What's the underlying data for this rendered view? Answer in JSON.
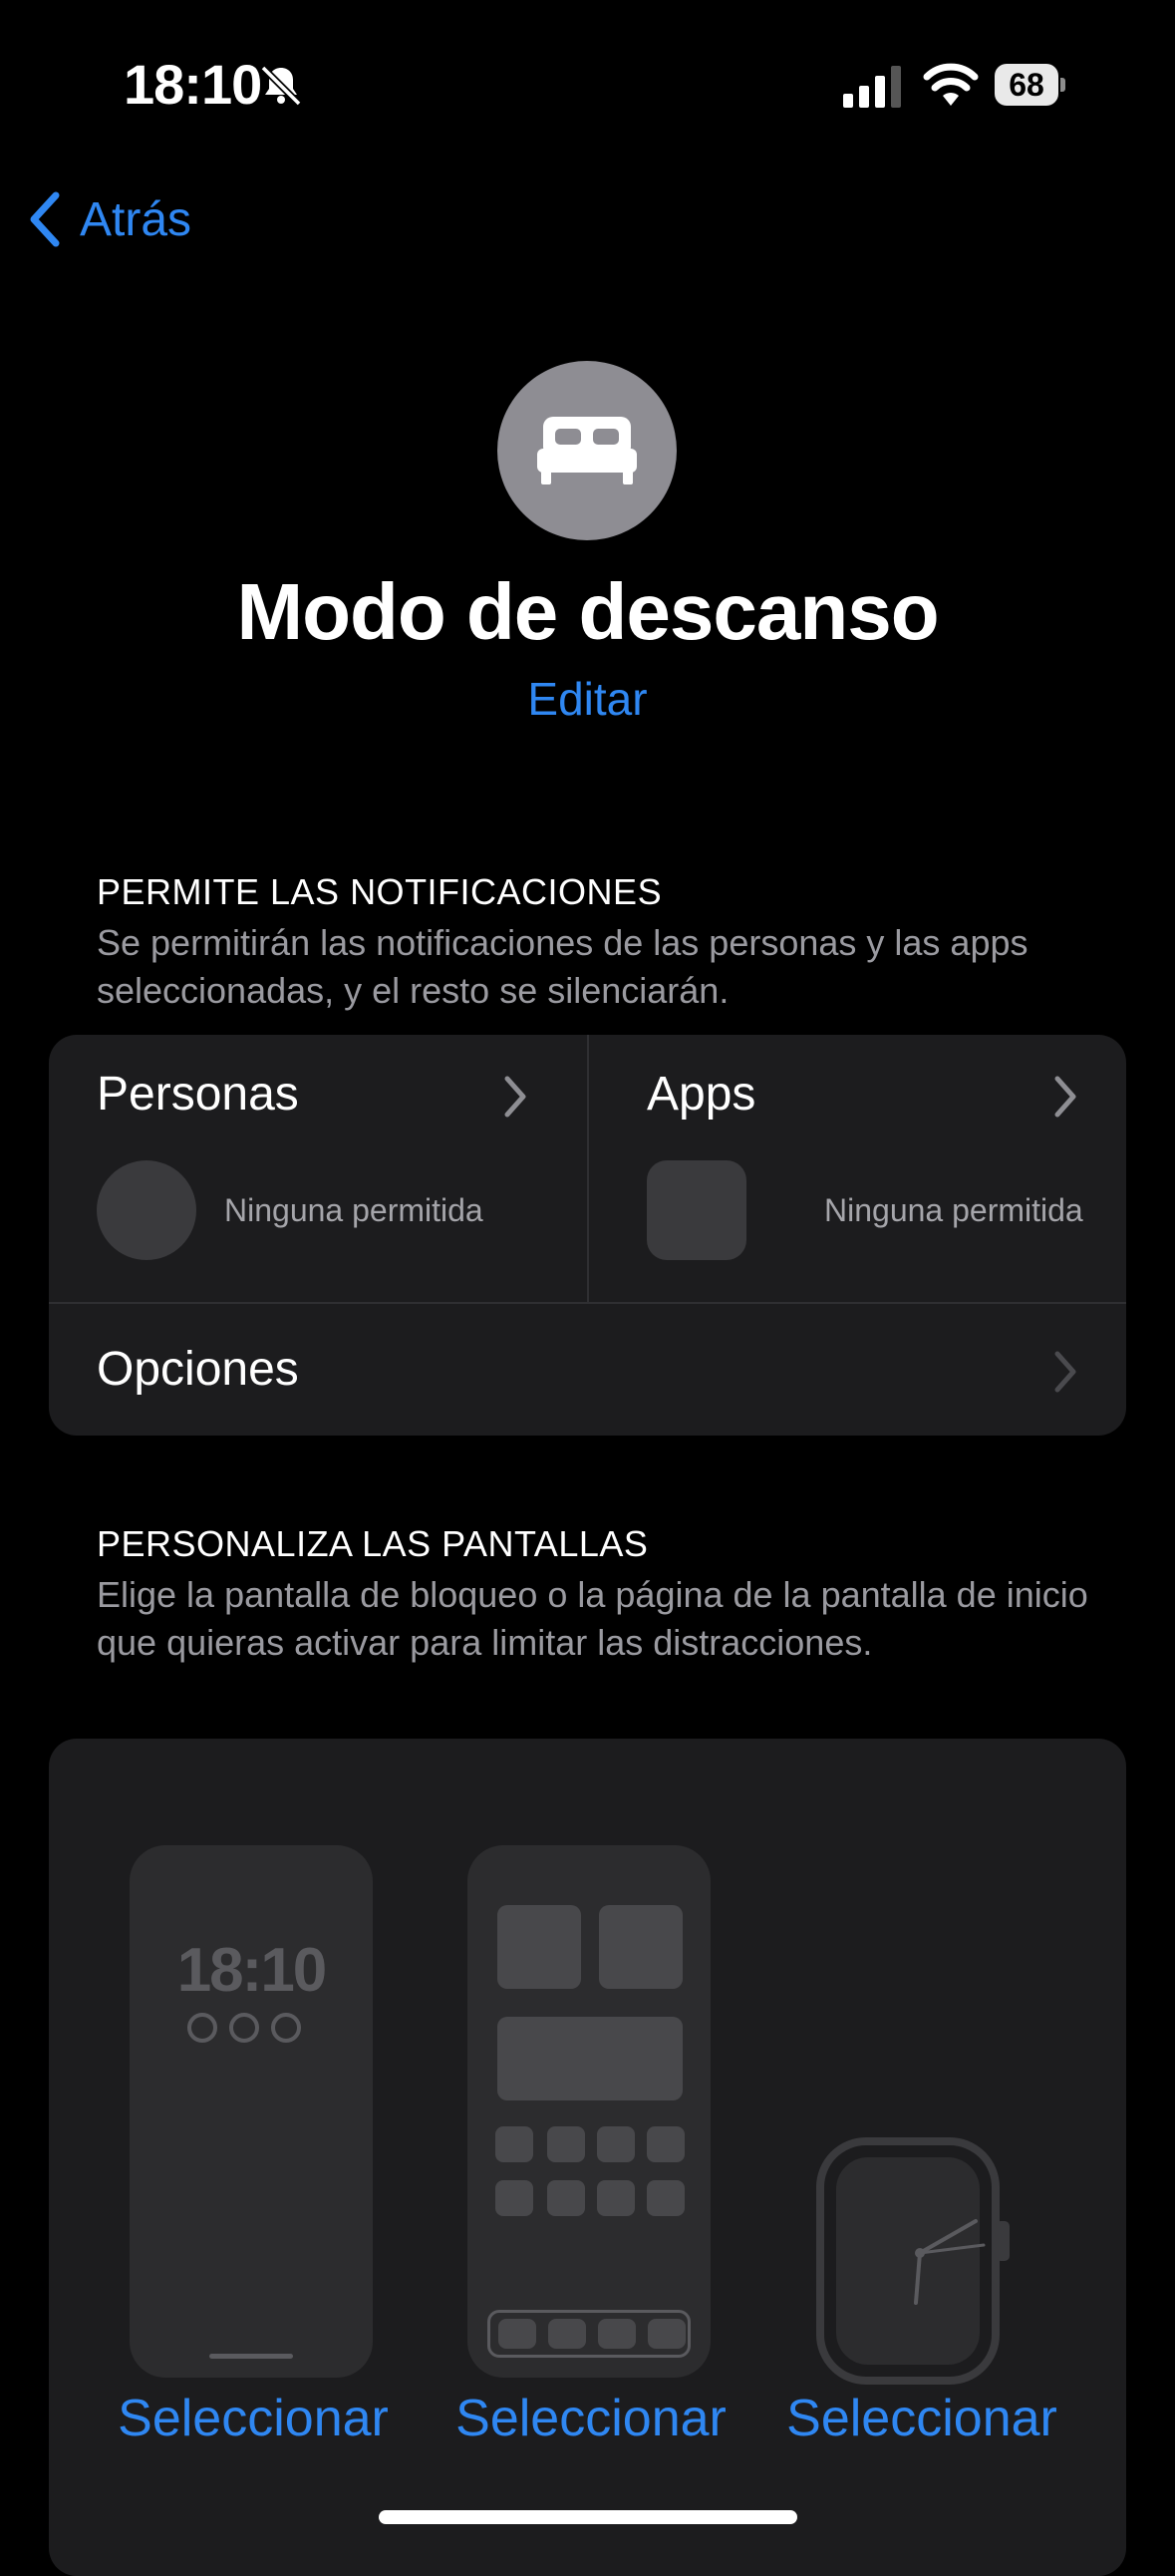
{
  "status_bar": {
    "time": "18:10",
    "battery": "68"
  },
  "nav": {
    "back_label": "Atrás"
  },
  "header": {
    "title": "Modo de descanso",
    "edit_label": "Editar"
  },
  "notifications": {
    "section_title": "PERMITE LAS NOTIFICACIONES",
    "section_description": "Se permitirán las notificaciones de las personas y las apps seleccionadas, y el resto se silenciarán.",
    "people": {
      "label": "Personas",
      "status": "Ninguna permitida"
    },
    "apps": {
      "label": "Apps",
      "status": "Ninguna permitida"
    },
    "options_label": "Opciones"
  },
  "screens": {
    "section_title": "PERSONALIZA LAS PANTALLAS",
    "section_description": "Elige la pantalla de bloqueo o la página de la pantalla de inicio que quieras activar para limitar las distracciones.",
    "lock_preview_time": "18:10",
    "select_lock": "Seleccionar",
    "select_home": "Seleccionar",
    "select_watch": "Seleccionar"
  },
  "colors": {
    "accent": "#2f87f2",
    "card": "#1c1c1e",
    "background": "#000000"
  }
}
